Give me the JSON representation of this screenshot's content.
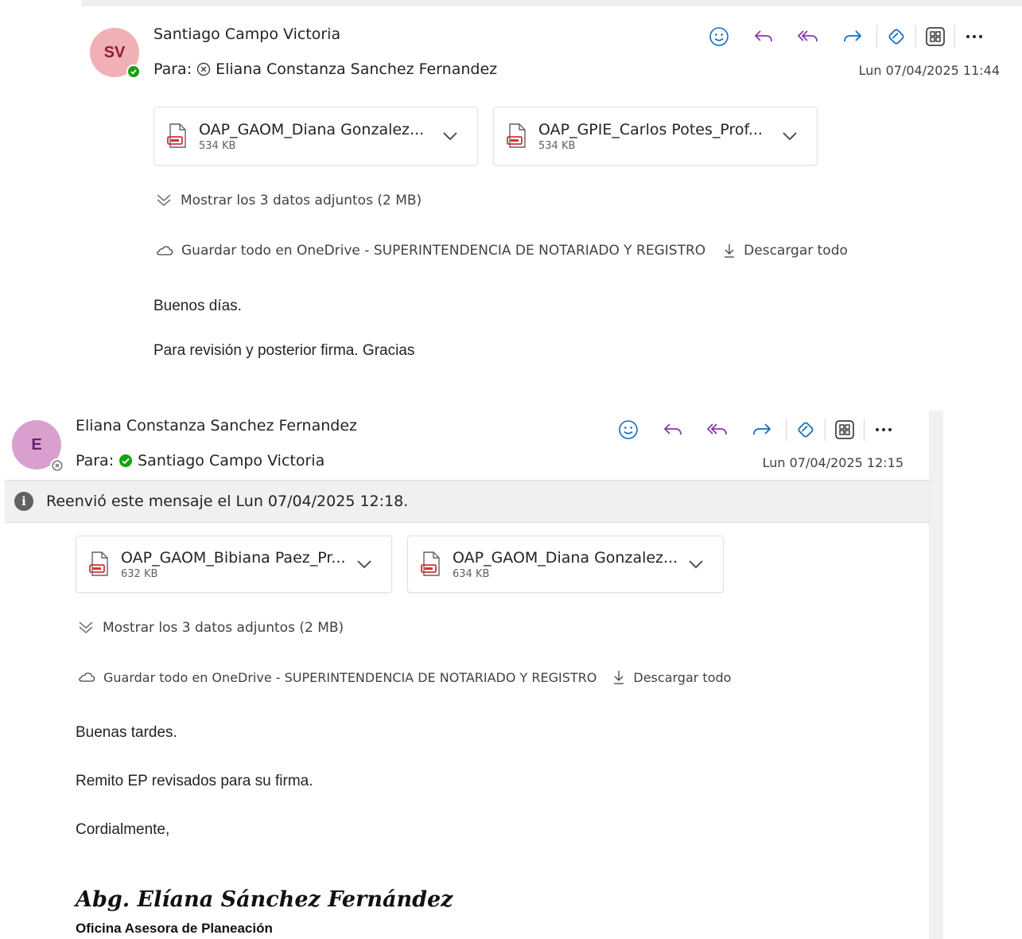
{
  "messages": [
    {
      "avatar_initials": "SV",
      "avatar_color": "#f1b0b5",
      "sender": "Santiago Campo Victoria",
      "to_label": "Para:",
      "recipient": "Eliana Constanza Sanchez Fernandez",
      "date": "Lun 07/04/2025 11:44",
      "attachments": [
        {
          "name": "OAP_GAOM_Diana Gonzalez...",
          "size": "534 KB"
        },
        {
          "name": "OAP_GPIE_Carlos Potes_Prof...",
          "size": "534 KB"
        }
      ],
      "show_all": "Mostrar los 3 datos adjuntos (2 MB)",
      "save_all": "Guardar todo en OneDrive - SUPERINTENDENCIA DE NOTARIADO Y REGISTRO",
      "download_all": "Descargar todo",
      "body": [
        "Buenos días.",
        "Para revisión y posterior firma. Gracias"
      ]
    },
    {
      "avatar_initials": "E",
      "avatar_color": "#d9a0cf",
      "sender": "Eliana Constanza Sanchez Fernandez",
      "to_label": "Para:",
      "recipient": "Santiago Campo Victoria",
      "date": "Lun 07/04/2025 12:15",
      "forwarded_notice": "Reenvió este mensaje el Lun 07/04/2025 12:18.",
      "attachments": [
        {
          "name": "OAP_GAOM_Bibiana Paez_Pr...",
          "size": "632 KB"
        },
        {
          "name": "OAP_GAOM_Diana Gonzalez...",
          "size": "634 KB"
        }
      ],
      "show_all": "Mostrar los 3 datos adjuntos (2 MB)",
      "save_all": "Guardar todo en OneDrive - SUPERINTENDENCIA DE NOTARIADO Y REGISTRO",
      "download_all": "Descargar todo",
      "body": [
        "Buenas tardes.",
        "Remito EP revisados para su firma.",
        "Cordialmente,"
      ],
      "signature_name": "Abg. Elíana Sánchez Fernández",
      "signature_title": "Oficina Asesora de Planeación"
    }
  ],
  "icons": {
    "actions": [
      "emoji-icon",
      "reply-icon",
      "reply-all-icon",
      "forward-icon",
      "loop-icon",
      "apps-icon",
      "more-icon"
    ],
    "attachment": "pdf-file-icon",
    "chevron": "chevron-down-icon",
    "show_all": "double-chevron-down-icon",
    "cloud": "cloud-icon",
    "download": "download-icon",
    "info": "info-icon"
  },
  "colors": {
    "accent_purple": "#8b3aa8",
    "accent_blue": "#0f6cbd",
    "presence_available": "#13a10e",
    "presence_offline": "#616161",
    "pdf_red": "#d13438"
  }
}
